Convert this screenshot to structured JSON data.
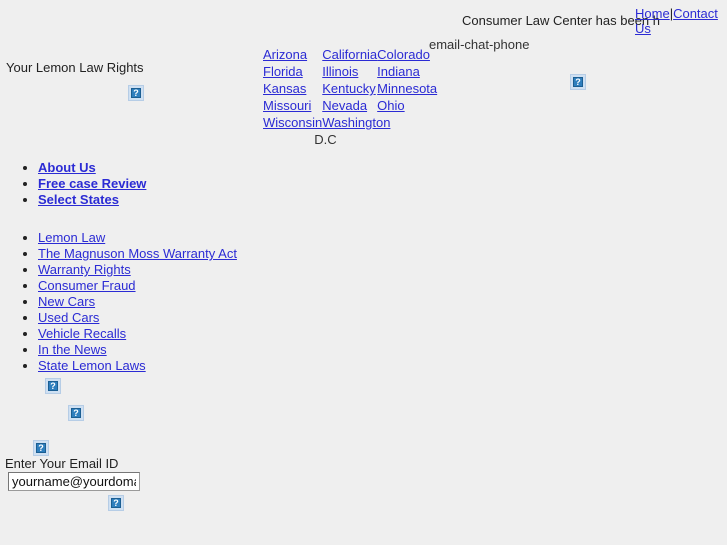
{
  "header": {
    "tagline": "Consumer Law Center has been h",
    "contact_modes": "email-chat-phone",
    "nav": [
      {
        "label": "Home"
      },
      {
        "label": "Contact Us"
      }
    ],
    "nav_separator": "|",
    "banner_icon": "broken-image-icon"
  },
  "section": {
    "title": "Your Lemon Law Rights",
    "logo_icon": "broken-image-icon"
  },
  "states": {
    "rows": [
      [
        "Arizona",
        "California",
        "Colorado"
      ],
      [
        "Florida",
        "Illinois",
        "Indiana"
      ],
      [
        "Kansas",
        "Kentucky",
        "Minnesota"
      ],
      [
        "Missouri",
        "Nevada",
        "Ohio"
      ],
      [
        "Wisconsin",
        "Washington",
        ""
      ]
    ],
    "wrapped_suffix": "D.C"
  },
  "primary_links": [
    {
      "label": "About Us"
    },
    {
      "label": "Free case Review"
    },
    {
      "label": "Select States"
    }
  ],
  "secondary_links": [
    {
      "label": "Lemon Law"
    },
    {
      "label": "The Magnuson Moss Warranty Act"
    },
    {
      "label": "Warranty Rights"
    },
    {
      "label": "Consumer Fraud"
    },
    {
      "label": "New Cars"
    },
    {
      "label": "Used Cars"
    },
    {
      "label": "Vehicle Recalls"
    },
    {
      "label": "In the News"
    },
    {
      "label": "State Lemon Laws"
    }
  ],
  "newsletter": {
    "label": "Enter Your Email ID",
    "value": "yourname@yourdomain.com",
    "placeholder": "yourname@yourdomain.com",
    "submit_icon": "broken-image-icon"
  },
  "placeholders": [
    {
      "name": "broken-image-icon"
    },
    {
      "name": "broken-image-icon"
    },
    {
      "name": "broken-image-icon"
    },
    {
      "name": "broken-image-icon"
    }
  ],
  "colors": {
    "background": "#efefef",
    "link": "#2b2bd4",
    "text": "#222222",
    "placeholder_fill": "#2e7ebd"
  }
}
